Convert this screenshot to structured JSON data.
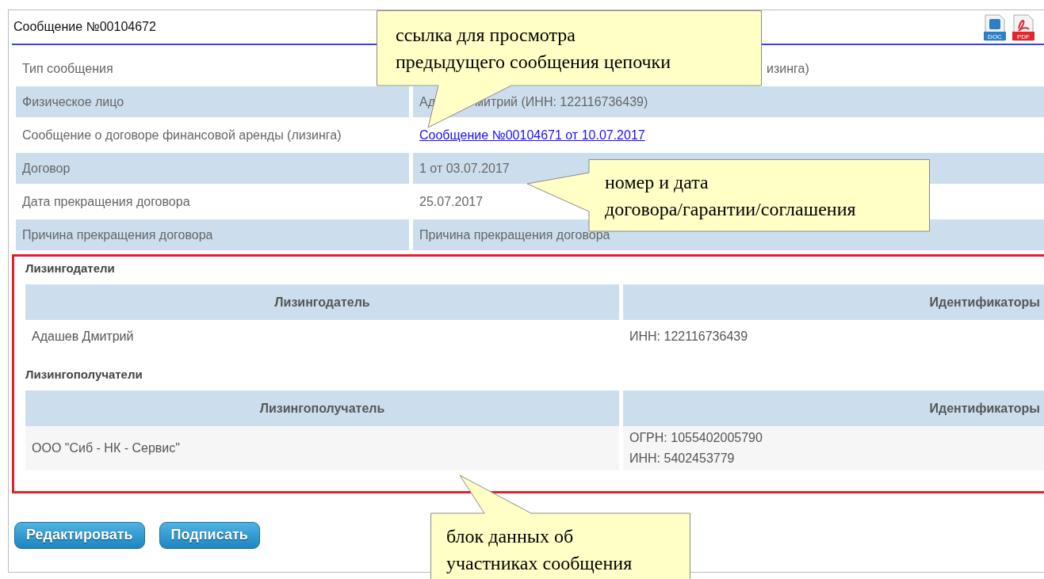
{
  "header": {
    "title": "Сообщение №00104672",
    "exports": [
      {
        "kind": "doc",
        "label": "DOC"
      },
      {
        "kind": "pdf",
        "label": "PDF"
      }
    ]
  },
  "details": [
    {
      "label": "Тип сообщения",
      "value": [
        "изинга)"
      ],
      "kind": "text"
    },
    {
      "label": "Физическое лицо",
      "value": [
        "Ад",
        "митрий (ИНН: 122116736439)"
      ],
      "kind": "text"
    },
    {
      "label": "Сообщение о договоре финансовой аренды (лизинга)",
      "value": [
        "Сообщение №00104671 от 10.07.2017"
      ],
      "kind": "link"
    },
    {
      "label": "Договор",
      "value": [
        "1 от 03.07.2017"
      ],
      "kind": "text"
    },
    {
      "label": "Дата прекращения договора",
      "value": [
        "25.07.2017"
      ],
      "kind": "text"
    },
    {
      "label": "Причина прекращения договора",
      "value": [
        "Причина прекращения договора"
      ],
      "kind": "text"
    }
  ],
  "participants": [
    {
      "heading": "Лизингодатели",
      "columns": [
        "Лизингодатель",
        "Идентификаторы"
      ],
      "rows": [
        {
          "name": "Адашев Дмитрий",
          "ids": [
            "ИНН: 122116736439"
          ]
        }
      ]
    },
    {
      "heading": "Лизингополучатели",
      "columns": [
        "Лизингополучатель",
        "Идентификаторы"
      ],
      "rows": [
        {
          "name": "ООО \"Сиб - НК - Сервис\"",
          "ids": [
            "ОГРН: 1055402005790",
            "ИНН: 5402453779"
          ]
        }
      ]
    }
  ],
  "buttons": [
    "Редактировать",
    "Подписать"
  ],
  "callouts": [
    {
      "text": "ссылка для просмотра\nпредыдущего сообщения цепочки"
    },
    {
      "text": "номер и дата\nдоговора/гарантии/соглашения"
    },
    {
      "text": "блок данных об\nучастниках сообщения"
    }
  ]
}
